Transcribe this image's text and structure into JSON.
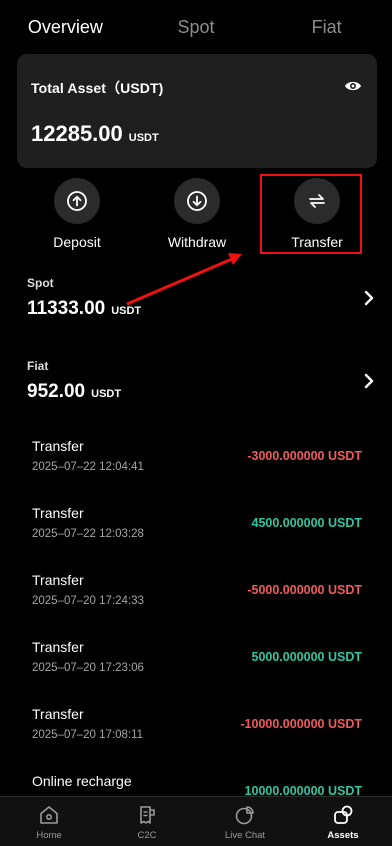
{
  "tabs": [
    {
      "label": "Overview",
      "active": true
    },
    {
      "label": "Spot",
      "active": false
    },
    {
      "label": "Fiat",
      "active": false
    }
  ],
  "total_asset": {
    "title": "Total Asset（USDT)",
    "amount": "12285.00",
    "unit": "USDT",
    "eye_icon": "eye-icon"
  },
  "actions": [
    {
      "label": "Deposit",
      "icon": "arrow-up-circle-icon"
    },
    {
      "label": "Withdraw",
      "icon": "arrow-down-circle-icon"
    },
    {
      "label": "Transfer",
      "icon": "swap-arrows-icon"
    }
  ],
  "accounts": [
    {
      "name": "Spot",
      "amount": "11333.00",
      "unit": "USDT"
    },
    {
      "name": "Fiat",
      "amount": "952.00",
      "unit": "USDT"
    }
  ],
  "records": [
    {
      "type": "Transfer",
      "time": "2025–07–22 12:04:41",
      "amount": "-3000.000000 USDT",
      "sign": "neg"
    },
    {
      "type": "Transfer",
      "time": "2025–07–22 12:03:28",
      "amount": "4500.000000 USDT",
      "sign": "pos"
    },
    {
      "type": "Transfer",
      "time": "2025–07–20 17:24:33",
      "amount": "-5000.000000 USDT",
      "sign": "neg"
    },
    {
      "type": "Transfer",
      "time": "2025–07–20 17:23:06",
      "amount": "5000.000000 USDT",
      "sign": "pos"
    },
    {
      "type": "Transfer",
      "time": "2025–07–20 17:08:11",
      "amount": "-10000.000000 USDT",
      "sign": "neg"
    },
    {
      "type": "Online recharge",
      "time": "",
      "amount": "10000.000000 USDT",
      "sign": "pos"
    }
  ],
  "bottom_nav": [
    {
      "label": "Home",
      "icon": "home-icon",
      "active": false
    },
    {
      "label": "C2C",
      "icon": "c2c-icon",
      "active": false
    },
    {
      "label": "Live Chat",
      "icon": "chat-icon",
      "active": false
    },
    {
      "label": "Assets",
      "icon": "assets-icon",
      "active": true
    }
  ],
  "colors": {
    "negative": "#f05a5a",
    "positive": "#2ec6a3",
    "annotation": "#ee1111",
    "card_bg": "#1f1f1f"
  }
}
